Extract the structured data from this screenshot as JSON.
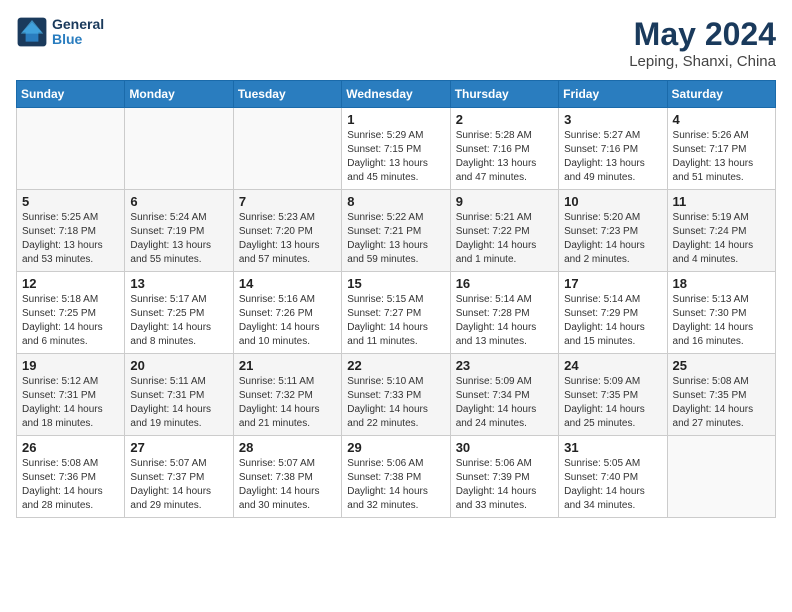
{
  "header": {
    "logo_line1": "General",
    "logo_line2": "Blue",
    "month_year": "May 2024",
    "location": "Leping, Shanxi, China"
  },
  "days_of_week": [
    "Sunday",
    "Monday",
    "Tuesday",
    "Wednesday",
    "Thursday",
    "Friday",
    "Saturday"
  ],
  "weeks": [
    [
      {
        "day": "",
        "info": ""
      },
      {
        "day": "",
        "info": ""
      },
      {
        "day": "",
        "info": ""
      },
      {
        "day": "1",
        "info": "Sunrise: 5:29 AM\nSunset: 7:15 PM\nDaylight: 13 hours\nand 45 minutes."
      },
      {
        "day": "2",
        "info": "Sunrise: 5:28 AM\nSunset: 7:16 PM\nDaylight: 13 hours\nand 47 minutes."
      },
      {
        "day": "3",
        "info": "Sunrise: 5:27 AM\nSunset: 7:16 PM\nDaylight: 13 hours\nand 49 minutes."
      },
      {
        "day": "4",
        "info": "Sunrise: 5:26 AM\nSunset: 7:17 PM\nDaylight: 13 hours\nand 51 minutes."
      }
    ],
    [
      {
        "day": "5",
        "info": "Sunrise: 5:25 AM\nSunset: 7:18 PM\nDaylight: 13 hours\nand 53 minutes."
      },
      {
        "day": "6",
        "info": "Sunrise: 5:24 AM\nSunset: 7:19 PM\nDaylight: 13 hours\nand 55 minutes."
      },
      {
        "day": "7",
        "info": "Sunrise: 5:23 AM\nSunset: 7:20 PM\nDaylight: 13 hours\nand 57 minutes."
      },
      {
        "day": "8",
        "info": "Sunrise: 5:22 AM\nSunset: 7:21 PM\nDaylight: 13 hours\nand 59 minutes."
      },
      {
        "day": "9",
        "info": "Sunrise: 5:21 AM\nSunset: 7:22 PM\nDaylight: 14 hours\nand 1 minute."
      },
      {
        "day": "10",
        "info": "Sunrise: 5:20 AM\nSunset: 7:23 PM\nDaylight: 14 hours\nand 2 minutes."
      },
      {
        "day": "11",
        "info": "Sunrise: 5:19 AM\nSunset: 7:24 PM\nDaylight: 14 hours\nand 4 minutes."
      }
    ],
    [
      {
        "day": "12",
        "info": "Sunrise: 5:18 AM\nSunset: 7:25 PM\nDaylight: 14 hours\nand 6 minutes."
      },
      {
        "day": "13",
        "info": "Sunrise: 5:17 AM\nSunset: 7:25 PM\nDaylight: 14 hours\nand 8 minutes."
      },
      {
        "day": "14",
        "info": "Sunrise: 5:16 AM\nSunset: 7:26 PM\nDaylight: 14 hours\nand 10 minutes."
      },
      {
        "day": "15",
        "info": "Sunrise: 5:15 AM\nSunset: 7:27 PM\nDaylight: 14 hours\nand 11 minutes."
      },
      {
        "day": "16",
        "info": "Sunrise: 5:14 AM\nSunset: 7:28 PM\nDaylight: 14 hours\nand 13 minutes."
      },
      {
        "day": "17",
        "info": "Sunrise: 5:14 AM\nSunset: 7:29 PM\nDaylight: 14 hours\nand 15 minutes."
      },
      {
        "day": "18",
        "info": "Sunrise: 5:13 AM\nSunset: 7:30 PM\nDaylight: 14 hours\nand 16 minutes."
      }
    ],
    [
      {
        "day": "19",
        "info": "Sunrise: 5:12 AM\nSunset: 7:31 PM\nDaylight: 14 hours\nand 18 minutes."
      },
      {
        "day": "20",
        "info": "Sunrise: 5:11 AM\nSunset: 7:31 PM\nDaylight: 14 hours\nand 19 minutes."
      },
      {
        "day": "21",
        "info": "Sunrise: 5:11 AM\nSunset: 7:32 PM\nDaylight: 14 hours\nand 21 minutes."
      },
      {
        "day": "22",
        "info": "Sunrise: 5:10 AM\nSunset: 7:33 PM\nDaylight: 14 hours\nand 22 minutes."
      },
      {
        "day": "23",
        "info": "Sunrise: 5:09 AM\nSunset: 7:34 PM\nDaylight: 14 hours\nand 24 minutes."
      },
      {
        "day": "24",
        "info": "Sunrise: 5:09 AM\nSunset: 7:35 PM\nDaylight: 14 hours\nand 25 minutes."
      },
      {
        "day": "25",
        "info": "Sunrise: 5:08 AM\nSunset: 7:35 PM\nDaylight: 14 hours\nand 27 minutes."
      }
    ],
    [
      {
        "day": "26",
        "info": "Sunrise: 5:08 AM\nSunset: 7:36 PM\nDaylight: 14 hours\nand 28 minutes."
      },
      {
        "day": "27",
        "info": "Sunrise: 5:07 AM\nSunset: 7:37 PM\nDaylight: 14 hours\nand 29 minutes."
      },
      {
        "day": "28",
        "info": "Sunrise: 5:07 AM\nSunset: 7:38 PM\nDaylight: 14 hours\nand 30 minutes."
      },
      {
        "day": "29",
        "info": "Sunrise: 5:06 AM\nSunset: 7:38 PM\nDaylight: 14 hours\nand 32 minutes."
      },
      {
        "day": "30",
        "info": "Sunrise: 5:06 AM\nSunset: 7:39 PM\nDaylight: 14 hours\nand 33 minutes."
      },
      {
        "day": "31",
        "info": "Sunrise: 5:05 AM\nSunset: 7:40 PM\nDaylight: 14 hours\nand 34 minutes."
      },
      {
        "day": "",
        "info": ""
      }
    ]
  ]
}
